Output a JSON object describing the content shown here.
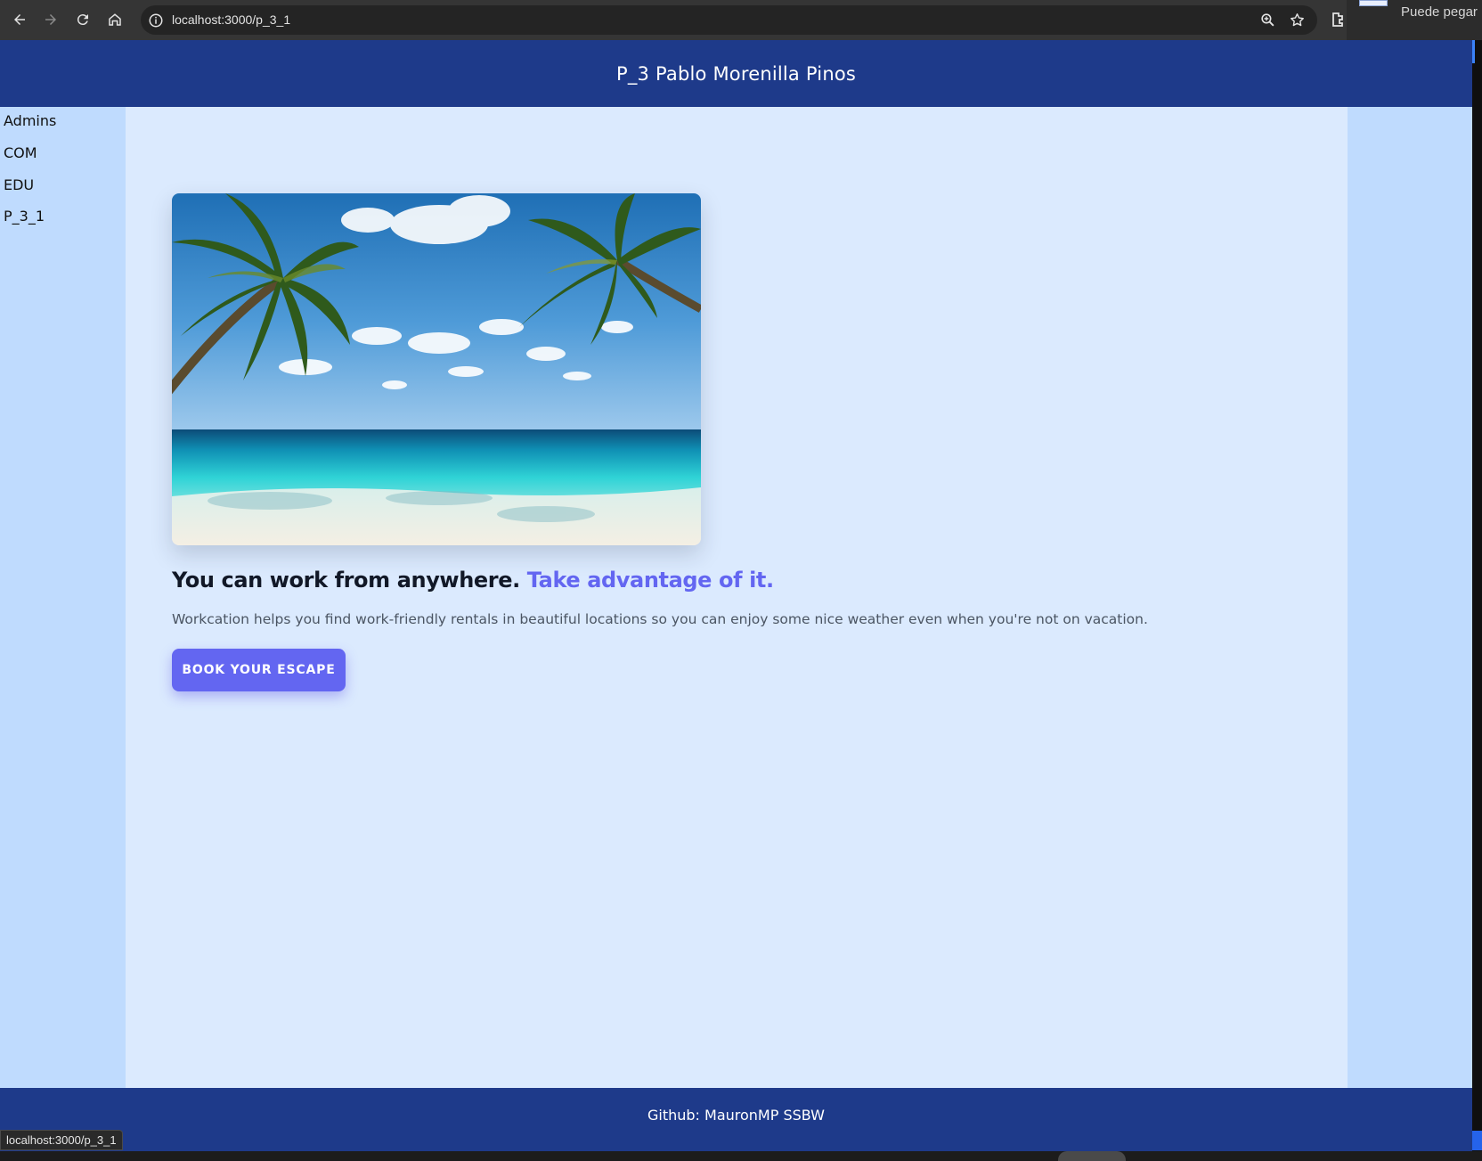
{
  "browser": {
    "url": "localhost:3000/p_3_1",
    "status_url": "localhost:3000/p_3_1",
    "side_panel_text": "Puede pegar l"
  },
  "header": {
    "title": "P_3 Pablo Morenilla Pinos"
  },
  "sidebar": {
    "items": [
      {
        "label": "Admins"
      },
      {
        "label": "COM"
      },
      {
        "label": "EDU"
      },
      {
        "label": "P_3_1"
      }
    ]
  },
  "hero": {
    "headline": "You can work from anywhere.",
    "headline_accent": "Take advantage of it.",
    "description": "Workcation helps you find work-friendly rentals in beautiful locations so you can enjoy some nice weather even when you're not on vacation.",
    "cta_label": "BOOK YOUR ESCAPE"
  },
  "footer": {
    "text": "Github: MauronMP SSBW"
  },
  "colors": {
    "header_bg": "#1e3a8a",
    "page_bg": "#bfdbfe",
    "main_bg": "#dbeafe",
    "accent": "#6366f1",
    "heading": "#111827",
    "body_text": "#4b5563"
  }
}
